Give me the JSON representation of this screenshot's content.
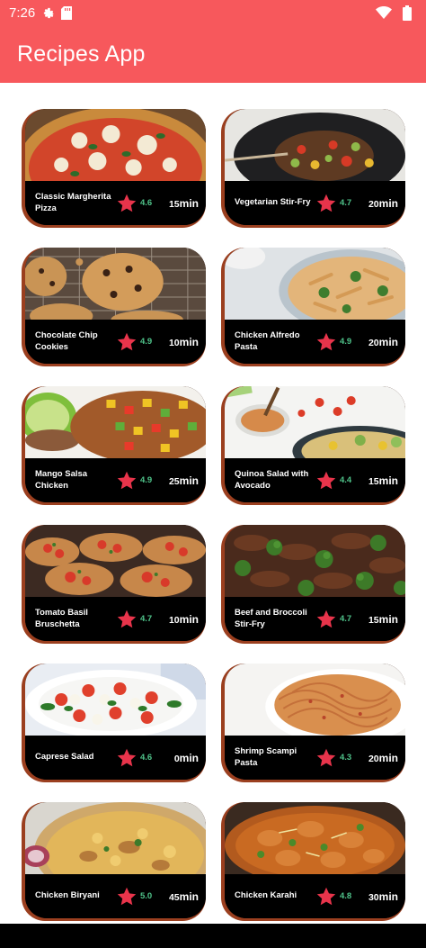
{
  "status_bar": {
    "time": "7:26",
    "icons": [
      "gear-icon",
      "sd-card-icon",
      "wifi-icon",
      "battery-icon"
    ]
  },
  "app_bar": {
    "title": "Recipes App",
    "color": "#f7585c"
  },
  "colors": {
    "card_border": "#9b3f1f",
    "card_bg": "#000000",
    "star": "#e8344b",
    "rating": "#4fc38a"
  },
  "recipes": [
    {
      "name": "Classic Margherita Pizza",
      "rating": "4.6",
      "time": "15",
      "unit": "min",
      "image": "pizza"
    },
    {
      "name": "Vegetarian Stir-Fry",
      "rating": "4.7",
      "time": "20",
      "unit": "min",
      "image": "stirfry"
    },
    {
      "name": "Chocolate Chip Cookies",
      "rating": "4.9",
      "time": "10",
      "unit": "min",
      "image": "cookies"
    },
    {
      "name": "Chicken Alfredo Pasta",
      "rating": "4.9",
      "time": "20",
      "unit": "min",
      "image": "alfredo"
    },
    {
      "name": "Mango Salsa Chicken",
      "rating": "4.9",
      "time": "25",
      "unit": "min",
      "image": "mango"
    },
    {
      "name": "Quinoa Salad with Avocado",
      "rating": "4.4",
      "time": "15",
      "unit": "min",
      "image": "quinoa"
    },
    {
      "name": "Tomato Basil Bruschetta",
      "rating": "4.7",
      "time": "10",
      "unit": "min",
      "image": "bruschetta"
    },
    {
      "name": "Beef and Broccoli Stir-Fry",
      "rating": "4.7",
      "time": "15",
      "unit": "min",
      "image": "beef"
    },
    {
      "name": "Caprese Salad",
      "rating": "4.6",
      "time": "0",
      "unit": "min",
      "image": "caprese"
    },
    {
      "name": "Shrimp Scampi Pasta",
      "rating": "4.3",
      "time": "20",
      "unit": "min",
      "image": "scampi"
    },
    {
      "name": "Chicken Biryani",
      "rating": "5.0",
      "time": "45",
      "unit": "min",
      "image": "biryani"
    },
    {
      "name": "Chicken Karahi",
      "rating": "4.8",
      "time": "30",
      "unit": "min",
      "image": "karahi"
    }
  ]
}
